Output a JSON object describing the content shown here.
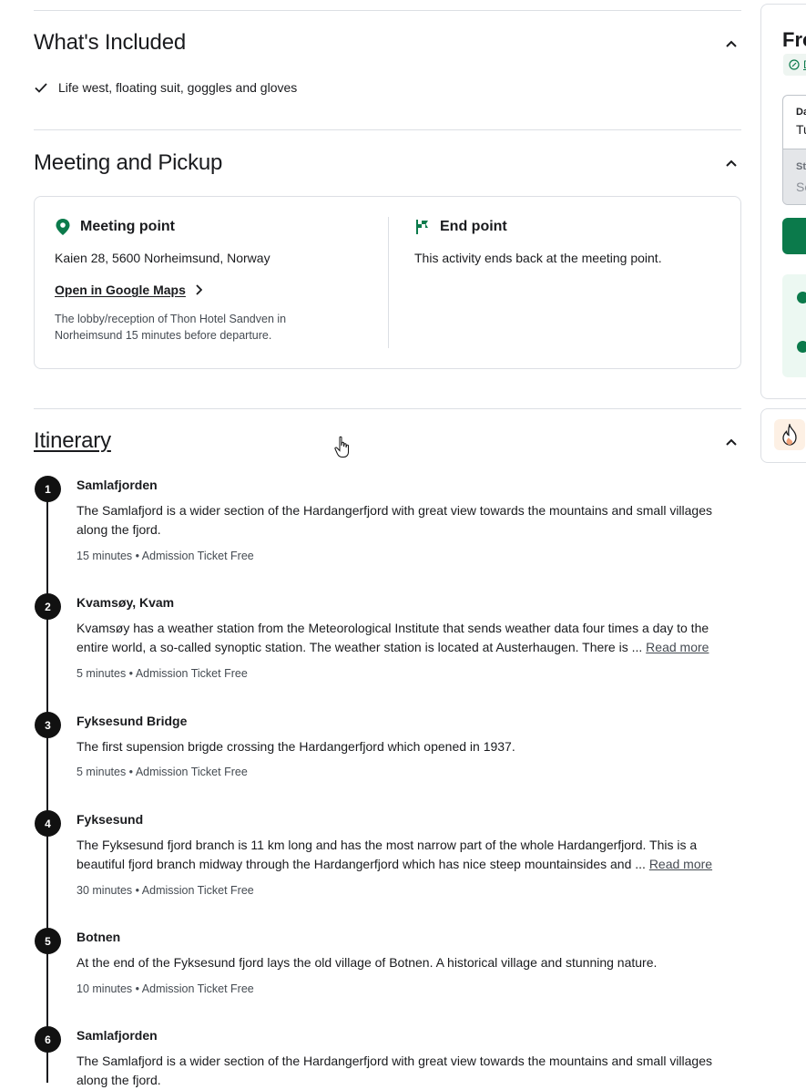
{
  "included": {
    "title": "What's Included",
    "items": [
      "Life west, floating suit, goggles and gloves"
    ]
  },
  "meeting": {
    "title": "Meeting and Pickup",
    "meeting_point": {
      "heading": "Meeting point",
      "address": "Kaien 28, 5600 Norheimsund, Norway",
      "maps_link": "Open in Google Maps",
      "note": "The lobby/reception of Thon Hotel Sandven in Norheimsund 15 minutes before departure."
    },
    "end_point": {
      "heading": "End point",
      "text": "This activity ends back at the meeting point."
    }
  },
  "itinerary": {
    "title": "Itinerary",
    "read_more": "Read more",
    "stops": [
      {
        "num": "1",
        "name": "Samlafjorden",
        "desc": "The Samlafjord is a wider section of the Hardangerfjord with great view towards the mountains and small villages along the fjord.",
        "meta": "15 minutes • Admission Ticket Free"
      },
      {
        "num": "2",
        "name": "Kvamsøy, Kvam",
        "desc": "Kvamsøy has a weather station from the Meteorological Institute that sends weather data four times a day to the entire world, a so-called synoptic station. The weather station is located at Austerhaugen. There is  ...",
        "meta": "5 minutes • Admission Ticket Free"
      },
      {
        "num": "3",
        "name": "Fyksesund Bridge",
        "desc": "The first supension brigde crossing the Hardangerfjord which opened in 1937.",
        "meta": "5 minutes • Admission Ticket Free"
      },
      {
        "num": "4",
        "name": "Fyksesund",
        "desc": "The Fyksesund fjord branch is 11 km long and has the most narrow part of the whole Hardangerfjord. This is a beautiful fjord branch midway through the Hardangerfjord which has nice steep mountainsides and ...",
        "meta": "30 minutes • Admission Ticket Free"
      },
      {
        "num": "5",
        "name": "Botnen",
        "desc": "At the end of the Fyksesund fjord lays the old village of Botnen. A historical village and stunning nature.",
        "meta": "10 minutes • Admission Ticket Free"
      },
      {
        "num": "6",
        "name": "Samlafjorden",
        "desc": "The Samlafjord is a wider section of the Hardangerfjord with great view towards the mountains and small villages along the fjord.",
        "meta": ""
      }
    ]
  },
  "sidebar": {
    "price_prefix": "Fro",
    "discount_letter": "D",
    "date_label": "Da",
    "date_value": "Tu",
    "travelers_label": "St",
    "travelers_value": "Se"
  },
  "colors": {
    "accent": "#0b7a4b",
    "text": "#1a1b1e",
    "muted": "#454b52",
    "border": "#dcdfe4"
  }
}
